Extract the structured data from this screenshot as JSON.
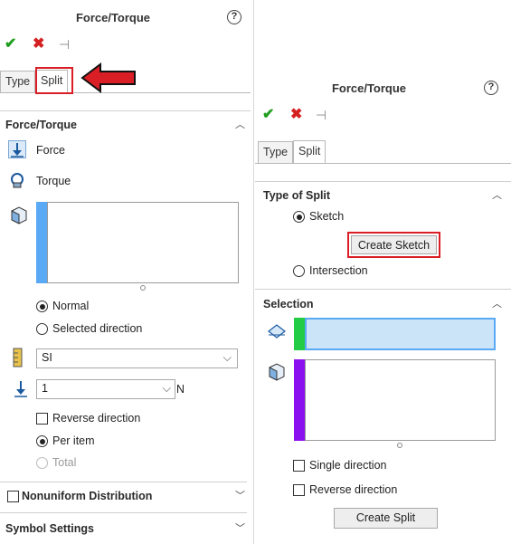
{
  "left": {
    "title": "Force/Torque",
    "help": "?",
    "tabs": [
      "Type",
      "Split"
    ],
    "section_force": {
      "title": "Force/Torque",
      "force_label": "Force",
      "torque_label": "Torque"
    },
    "radio_normal": "Normal",
    "radio_selected_direction": "Selected direction",
    "unit_select": "SI",
    "value_input": "1",
    "unit_label": "N",
    "reverse_direction": "Reverse direction",
    "per_item": "Per item",
    "total": "Total",
    "nonuniform": "Nonuniform Distribution",
    "symbol_settings": "Symbol Settings"
  },
  "right": {
    "title": "Force/Torque",
    "help": "?",
    "tabs": [
      "Type",
      "Split"
    ],
    "type_of_split": "Type of Split",
    "sketch": "Sketch",
    "create_sketch": "Create Sketch",
    "intersection": "Intersection",
    "selection": "Selection",
    "single_direction": "Single direction",
    "reverse_direction": "Reverse direction",
    "create_split": "Create Split"
  },
  "colors": {
    "accent_blue": "#5aa9f5",
    "accent_green": "#22cc44",
    "accent_purple": "#8b10ef",
    "highlight_red": "#d91e25",
    "selection_fill": "#cce4f7"
  }
}
